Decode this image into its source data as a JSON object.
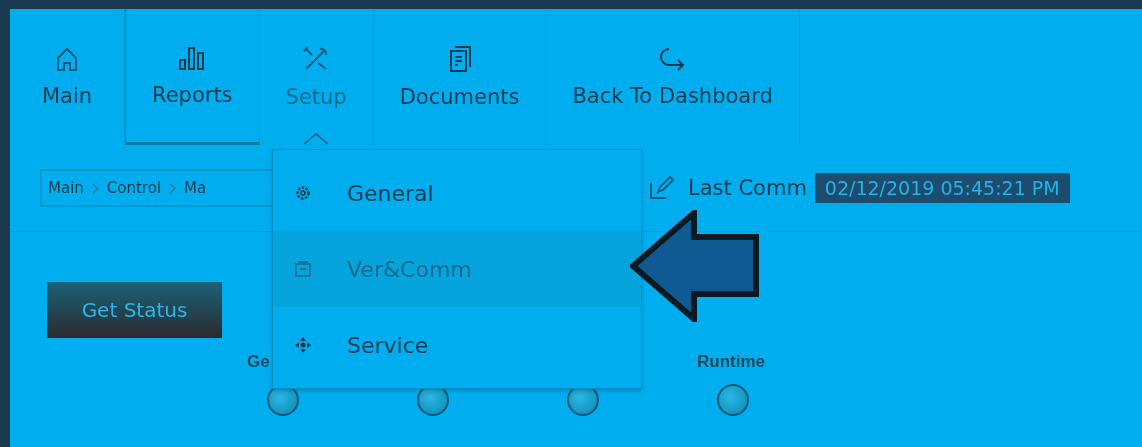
{
  "tabs": [
    {
      "label": "Main",
      "selected": false
    },
    {
      "label": "Reports",
      "selected": false
    },
    {
      "label": "Setup",
      "selected": true
    },
    {
      "label": "Documents",
      "selected": false
    },
    {
      "label": "Back To Dashboard",
      "selected": false
    }
  ],
  "breadcrumb": [
    "Main",
    "Control",
    "Ma"
  ],
  "last_comm": {
    "label": "Last Comm",
    "value": "02/12/2019 05:45:21 PM"
  },
  "get_status_button": "Get Status",
  "indicators": [
    {
      "kind": "light",
      "label": "Ge"
    },
    {
      "kind": "light"
    },
    {
      "kind": "light"
    },
    {
      "kind": "light",
      "label": "Runtime"
    }
  ],
  "setup_menu": [
    {
      "label": "General",
      "selected": false
    },
    {
      "label": "Ver&Comm",
      "selected": true
    },
    {
      "label": "Service",
      "selected": false
    }
  ]
}
